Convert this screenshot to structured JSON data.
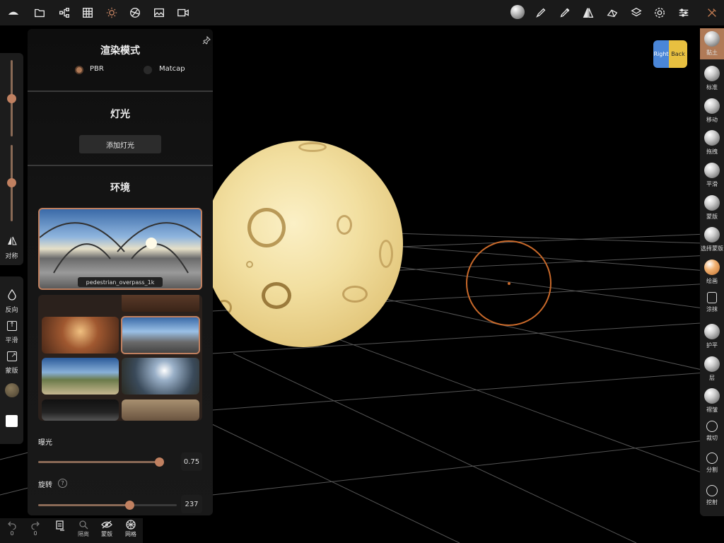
{
  "top_toolbar": {
    "icons_left": [
      "app-logo-icon",
      "folder-icon",
      "scene-tree-icon",
      "grid-icon",
      "light-icon",
      "material-icon",
      "image-icon",
      "video-icon"
    ],
    "icons_right": [
      "matcap-sphere-icon",
      "brush-icon",
      "pen-tool-icon",
      "symmetry-icon",
      "retopo-icon",
      "layers-icon",
      "settings-icon",
      "sliders-icon",
      "tools-icon"
    ]
  },
  "left_panel": {
    "symmetry_label": "对称",
    "invert_label": "反向",
    "smooth_label": "平滑",
    "mask_label": "蒙版"
  },
  "render_panel": {
    "render_mode_title": "渲染模式",
    "mode_pbr": "PBR",
    "mode_matcap": "Matcap",
    "selected_mode": "PBR",
    "lighting_title": "灯光",
    "add_light_label": "添加灯光",
    "environment_title": "环境",
    "selected_env_name": "pedestrian_overpass_1k",
    "exposure_label": "曝光",
    "exposure_value": "0.75",
    "rotation_label": "旋转",
    "rotation_value": "237",
    "exposure_fraction": 0.92,
    "rotation_fraction": 0.66
  },
  "view_cube": {
    "right_label": "Right",
    "back_label": "Back"
  },
  "right_toolbar": {
    "tools": [
      {
        "label": "黏土",
        "active": true
      },
      {
        "label": "标准",
        "active": false
      },
      {
        "label": "移动",
        "active": false
      },
      {
        "label": "拖拽",
        "active": false
      },
      {
        "label": "平滑",
        "active": false
      },
      {
        "label": "蒙版",
        "active": false
      },
      {
        "label": "选择蒙版",
        "active": false
      },
      {
        "label": "绘画",
        "active": false
      },
      {
        "label": "涂抹",
        "active": false
      },
      {
        "label": "护平",
        "active": false
      },
      {
        "label": "层",
        "active": false
      },
      {
        "label": "褶皱",
        "active": false
      },
      {
        "label": "裁切",
        "active": false
      },
      {
        "label": "分割",
        "active": false
      },
      {
        "label": "挖射",
        "active": false
      }
    ]
  },
  "bottom_bar": {
    "undo_count": "0",
    "redo_count": "0",
    "isolate_label": "隔离",
    "mask_label": "蒙版",
    "wireframe_label": "网格"
  },
  "colors": {
    "accent": "#c08060",
    "panel": "#1c1c1c",
    "topbar": "#1a1a1a",
    "brush_ring": "#c9692a"
  }
}
